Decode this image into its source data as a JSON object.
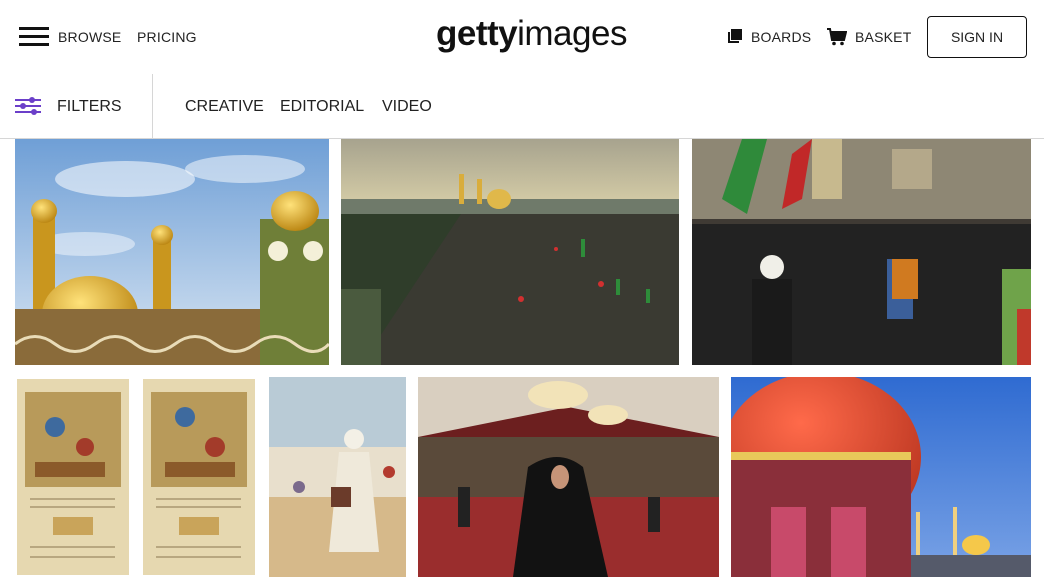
{
  "header": {
    "nav": {
      "browse": "BROWSE",
      "pricing": "PRICING"
    },
    "logo": {
      "part1": "getty",
      "part2": "images"
    },
    "boards": "BOARDS",
    "basket": "BASKET",
    "sign_in": "SIGN IN"
  },
  "filterbar": {
    "filters_label": "FILTERS",
    "tabs": [
      "CREATIVE",
      "EDITORIAL",
      "VIDEO"
    ]
  },
  "icons": {
    "menu": "hamburger-menu-icon",
    "boards": "boards-icon",
    "basket": "basket-icon",
    "filters": "sliders-icon"
  },
  "colors": {
    "accent": "#6b3fc9",
    "text": "#222222",
    "border": "#d6d6d6"
  },
  "results": [
    "Gold domes and minarets of a shrine under a blue cloudy sky",
    "Aerial view of a massive crowd of pilgrims near golden shrines",
    "Crowd of pilgrims walking in a street with green and red flags",
    "Two pages of an illuminated Persian manuscript with battle scenes",
    "Painting of a robed man with a turban among people in a desert",
    "Woman in black chador praying inside an ornate shrine hall",
    "Shrine dome glowing red at dusk with illuminated minarets"
  ]
}
